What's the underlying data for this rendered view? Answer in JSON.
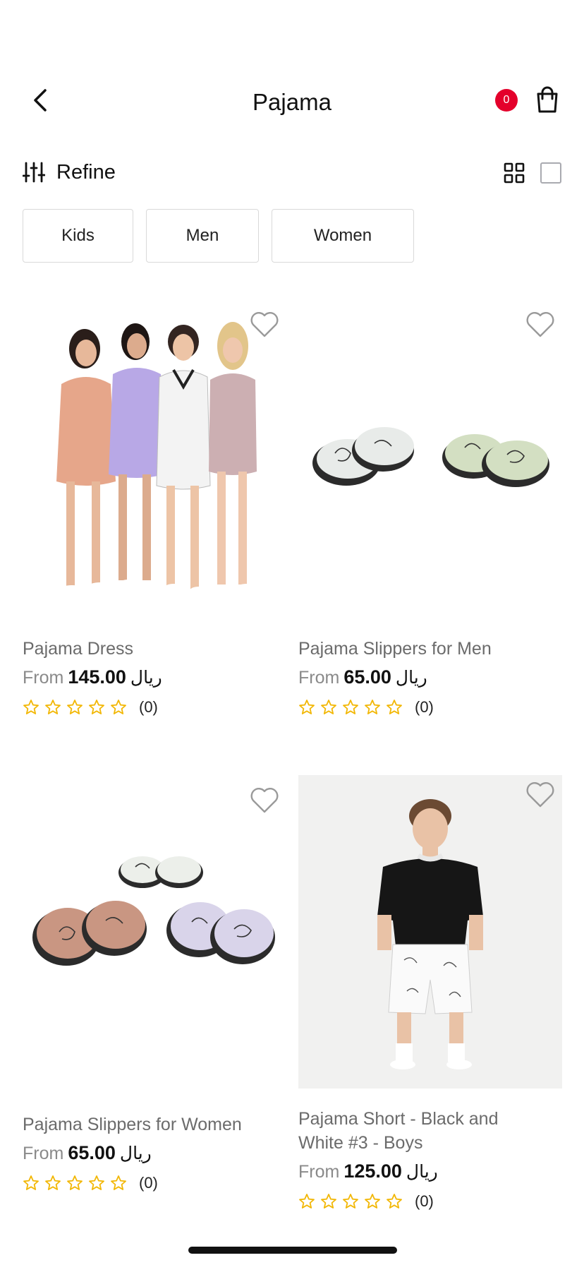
{
  "header": {
    "title": "Pajama",
    "cart_count": "0"
  },
  "toolbar": {
    "refine_label": "Refine"
  },
  "categories": [
    "Kids",
    "Men",
    "Women"
  ],
  "products": [
    {
      "name": "Pajama Dress",
      "from": "From",
      "price": "145.00",
      "currency": "ريال",
      "reviews": "(0)"
    },
    {
      "name": "Pajama Slippers for Men",
      "from": "From",
      "price": "65.00",
      "currency": "ريال",
      "reviews": "(0)"
    },
    {
      "name": "Pajama Slippers for Women",
      "from": "From",
      "price": "65.00",
      "currency": "ريال",
      "reviews": "(0)"
    },
    {
      "name": "Pajama Short - Black and White #3 - Boys",
      "from": "From",
      "price": "125.00",
      "currency": "ريال",
      "reviews": "(0)"
    }
  ],
  "colors": {
    "badge": "#e4002b",
    "star": "#f2b705",
    "heart": "#9a9a9a"
  },
  "icons": {
    "back": "chevron-left-icon",
    "cart": "shopping-bag-icon",
    "refine": "sliders-icon",
    "grid": "grid-view-icon",
    "single": "single-view-icon",
    "wishlist": "heart-outline-icon",
    "rating": "star-outline-icon"
  }
}
